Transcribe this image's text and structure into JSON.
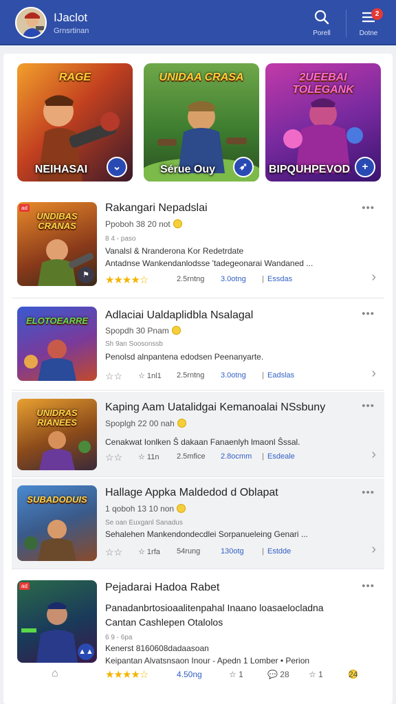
{
  "header": {
    "title": "IJaclot",
    "subtitle": "Grnsrtinan",
    "search_label": "Porell",
    "menu_label": "Dotne",
    "menu_badge": "2"
  },
  "featured": [
    {
      "label": "NEIHASAI",
      "logo": "RAGE",
      "button_icon": "chevron-down-icon"
    },
    {
      "label": "Sérue Ouy",
      "logo": "UNIDAA CRASA",
      "button_icon": "share-icon"
    },
    {
      "label": "BIPQUHPEVOD",
      "logo": "2UEEBAI TOLEGANK",
      "button_icon": "plus-icon"
    }
  ],
  "items": [
    {
      "title": "Rakangari Nepadslai",
      "meta": "Ppoboh 38 20 not",
      "tiny": "8 4 - paso",
      "desc_lines": [
        "Vanalsl & Nranderona Kor Redetrdate",
        "Antadnse Wankendanlodsse 'tadegeonarai Wandaned ..."
      ],
      "rating_text": "★★★★☆",
      "stat1": "2.5rntng",
      "stat2": "3.0otng",
      "stat3": "Essdas",
      "thumb_logo": "UNDIBAS CRANAS",
      "tag": "ad",
      "rating": 4.5
    },
    {
      "title": "Adlaciai Ualdaplidbla Nsalagal",
      "meta": "Spopdh 30 Pnam",
      "tiny": "Sh 9an Soosonssb",
      "desc_lines": [
        "Penolsd alnpantena edodsen Peenanyarte."
      ],
      "rating_text": "☆☆",
      "stat0": "☆ 1nl1",
      "stat1": "2.5rntng",
      "stat2": "3.0otng",
      "stat3": "Eadslas",
      "thumb_logo": "ELOTOEARRE",
      "tag": "",
      "rating": 0
    },
    {
      "title": "Kaping Aam Uatalidgai Kemanoalai NSsbuny",
      "meta": "Spoplgh 22 00 nah",
      "tiny": "",
      "desc_lines": [
        "Cenakwat Ionlken Ŝ dakaan Fanaenlyh lmaonl Ŝssal."
      ],
      "rating_text": "☆☆",
      "stat0": "☆ 11n",
      "stat1": "2.5mfice",
      "stat2": "2.8ocmm",
      "stat3": "Esdeale",
      "thumb_logo": "UNIDRAS RIANEES",
      "tag": "",
      "rating": 0
    },
    {
      "title": "Hallage Appka Maldedod d Oblapat",
      "meta": "1 qoboh 13 10 non",
      "tiny": "Se oan Euxganl Sanadus",
      "desc_lines": [
        "Sehalehen Mankendondecdlei Sorpanueleing Genari ..."
      ],
      "rating_text": "☆☆",
      "stat0": "☆ 1rfa",
      "stat1": "54rung",
      "stat2": "130otg",
      "stat3": "Estdde",
      "thumb_logo": "SUBADODUIS",
      "tag": "",
      "rating": 0
    },
    {
      "title": "Pejadarai Hadoa Rabet",
      "meta": "",
      "tiny": "6 9 - 6pa",
      "desc_large": [
        "Panadanbrtosioaalitenpahal Inaano loasaelocladna",
        "Cantan Cashlepen Otalolos"
      ],
      "desc_lines": [
        "Kenerst 8160608dadaasoan",
        "Keipantan Alvatsnsaon Inour - Apedn 1 Lomber • Perion"
      ],
      "rating_text": "★★★★☆",
      "stat1": "4.50ng",
      "stat2": "☆ 1",
      "stat3": "💬 28",
      "stat4": "☆ 1",
      "stat5": "24",
      "thumb_logo": "",
      "tag": "ad",
      "rating": 4.5
    }
  ],
  "colors": {
    "header_bg": "#2f4fa8",
    "accent": "#2a4ab3",
    "star": "#f4b400",
    "ad_tag": "#e53935"
  }
}
